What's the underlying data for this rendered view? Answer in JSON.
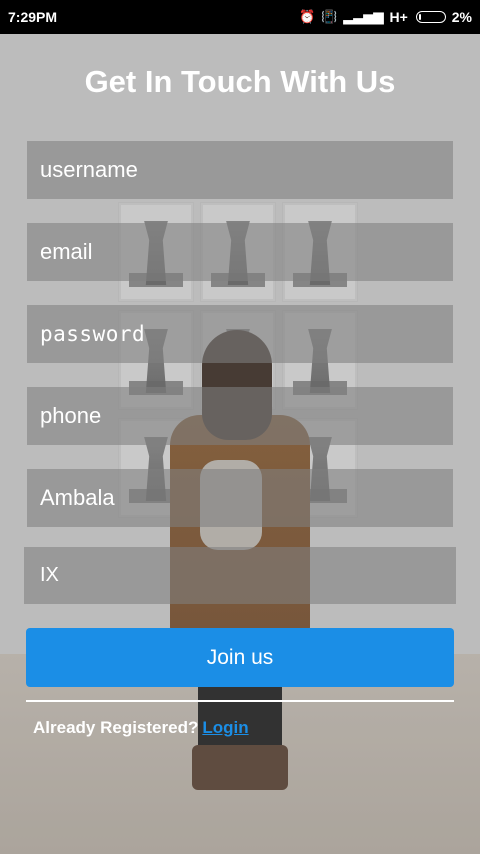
{
  "status_bar": {
    "time": "7:29PM",
    "network": "H+",
    "battery": "2%"
  },
  "page": {
    "title": "Get In Touch With Us"
  },
  "form": {
    "username_placeholder": "username",
    "email_placeholder": "email",
    "password_placeholder": "password",
    "phone_placeholder": "phone",
    "city_value": "Ambala",
    "class_value": "IX",
    "submit_label": "Join us"
  },
  "footer": {
    "already_text": "Already Registered?",
    "login_label": "Login"
  },
  "colors": {
    "accent": "#1b8ee6"
  }
}
